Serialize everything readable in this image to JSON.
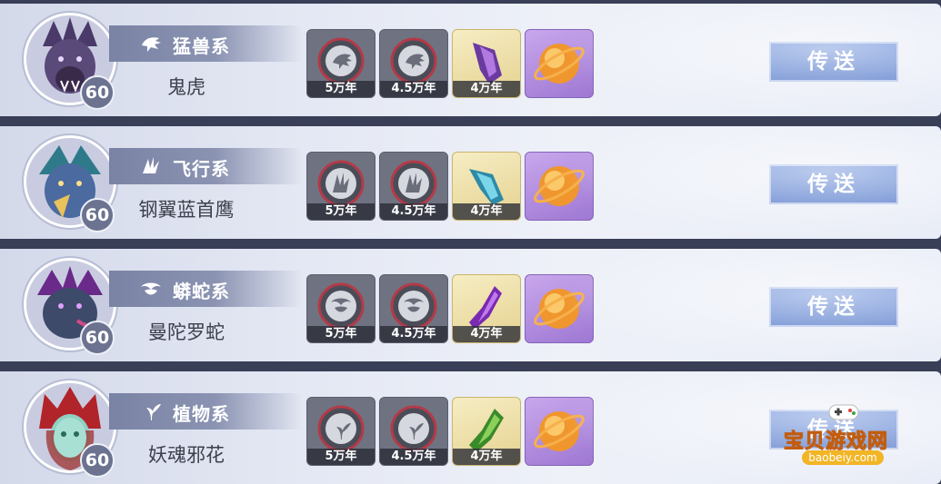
{
  "rows": [
    {
      "level": "60",
      "type_label": "猛兽系",
      "type_icon": "beast-sigil-icon",
      "name": "鬼虎",
      "avatar_icon": "ghost-tiger-portrait",
      "avatar_color": "#5a4a7a",
      "slots": [
        {
          "label": "5万年",
          "icon": "beast-soul-ring-icon"
        },
        {
          "label": "4.5万年",
          "icon": "beast-soul-ring-icon"
        },
        {
          "label": "4万年",
          "icon": "purple-claw-bone-icon"
        },
        {
          "label": "",
          "icon": "orange-soul-orb-icon"
        }
      ],
      "button_label": "传送"
    },
    {
      "level": "60",
      "type_label": "飞行系",
      "type_icon": "wing-sigil-icon",
      "name": "钢翼蓝首鹰",
      "avatar_icon": "steel-wing-eagle-portrait",
      "avatar_color": "#4a6aa0",
      "slots": [
        {
          "label": "5万年",
          "icon": "wing-soul-ring-icon"
        },
        {
          "label": "4.5万年",
          "icon": "wing-soul-ring-icon"
        },
        {
          "label": "4万年",
          "icon": "blue-wing-bone-icon"
        },
        {
          "label": "",
          "icon": "orange-soul-orb-icon"
        }
      ],
      "button_label": "传送"
    },
    {
      "level": "60",
      "type_label": "蟒蛇系",
      "type_icon": "serpent-sigil-icon",
      "name": "曼陀罗蛇",
      "avatar_icon": "mandala-snake-portrait",
      "avatar_color": "#3d4a6a",
      "slots": [
        {
          "label": "5万年",
          "icon": "serpent-soul-ring-icon"
        },
        {
          "label": "4.5万年",
          "icon": "serpent-soul-ring-icon"
        },
        {
          "label": "4万年",
          "icon": "purple-fang-bone-icon"
        },
        {
          "label": "",
          "icon": "orange-soul-orb-icon"
        }
      ],
      "button_label": "传送"
    },
    {
      "level": "60",
      "type_label": "植物系",
      "type_icon": "plant-sigil-icon",
      "name": "妖魂邪花",
      "avatar_icon": "demon-flower-portrait",
      "avatar_color": "#a03a3a",
      "slots": [
        {
          "label": "5万年",
          "icon": "plant-soul-ring-icon"
        },
        {
          "label": "4.5万年",
          "icon": "plant-soul-ring-icon"
        },
        {
          "label": "4万年",
          "icon": "green-vine-bone-icon"
        },
        {
          "label": "",
          "icon": "orange-soul-orb-icon"
        }
      ],
      "button_label": "传送"
    }
  ],
  "watermark": {
    "title": "宝贝游戏网",
    "url": "baobeiy.com"
  },
  "colors": {
    "panel_bg": "#3a3f58",
    "row_bg": "#e3e7f3",
    "banner": "#7a83a4",
    "button": "#5a7ecb",
    "gold_slot": "#e5d28f",
    "purple_slot": "#9e78d3"
  }
}
